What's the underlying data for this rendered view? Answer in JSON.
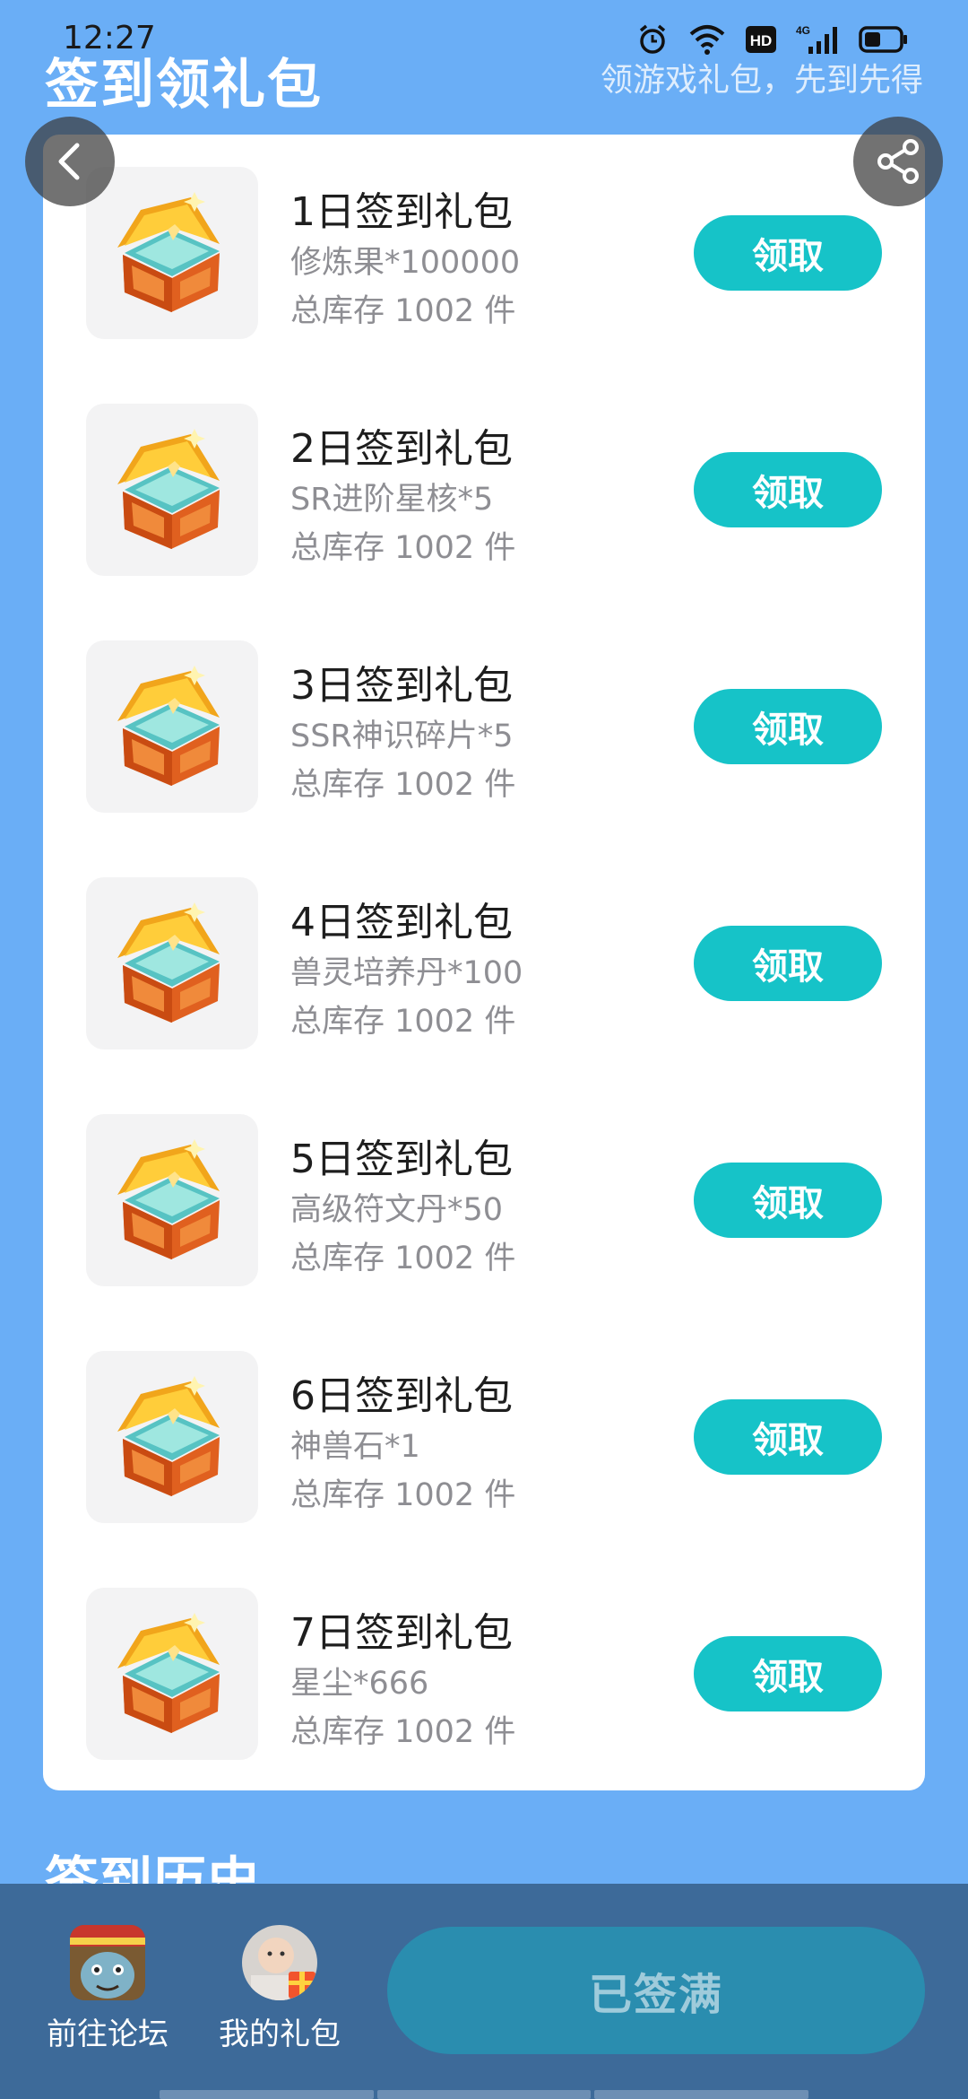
{
  "status_bar": {
    "time": "12:27",
    "signal_label": "4G",
    "hd_label": "HD"
  },
  "header": {
    "title": "签到领礼包",
    "subtitle": "领游戏礼包，先到先得"
  },
  "gifts": [
    {
      "name": "1日签到礼包",
      "item": "修炼果*100000",
      "stock": "总库存 1002 件",
      "button": "领取"
    },
    {
      "name": "2日签到礼包",
      "item": "SR进阶星核*5",
      "stock": "总库存 1002 件",
      "button": "领取"
    },
    {
      "name": "3日签到礼包",
      "item": "SSR神识碎片*5",
      "stock": "总库存 1002 件",
      "button": "领取"
    },
    {
      "name": "4日签到礼包",
      "item": "兽灵培养丹*100",
      "stock": "总库存 1002 件",
      "button": "领取"
    },
    {
      "name": "5日签到礼包",
      "item": "高级符文丹*50",
      "stock": "总库存 1002 件",
      "button": "领取"
    },
    {
      "name": "6日签到礼包",
      "item": "神兽石*1",
      "stock": "总库存 1002 件",
      "button": "领取"
    },
    {
      "name": "7日签到礼包",
      "item": "星尘*666",
      "stock": "总库存 1002 件",
      "button": "领取"
    }
  ],
  "history": {
    "title": "签到历史"
  },
  "bottom_bar": {
    "forum_label": "前往论坛",
    "my_gifts_label": "我的礼包",
    "signed_button": "已签满"
  },
  "colors": {
    "background": "#6aaef6",
    "accent": "#16c3c8",
    "bottom_bar": "#3d6a99",
    "signed_button": "#2a8daf"
  },
  "icons": {
    "back": "chevron-left-icon",
    "share": "share-icon",
    "gift_thumb": "treasure-chest-icon",
    "forum": "game-avatar-icon",
    "my_gifts": "user-gift-avatar-icon"
  }
}
